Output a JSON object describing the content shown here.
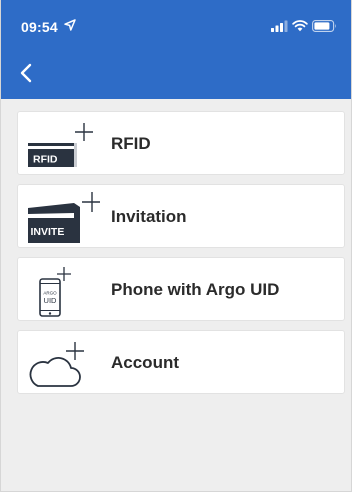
{
  "status_bar": {
    "time": "09:54"
  },
  "menu": {
    "items": [
      {
        "label": "RFID",
        "icon": "rfid-card-icon",
        "card_text": "RFID"
      },
      {
        "label": "Invitation",
        "icon": "invite-card-icon",
        "card_text": "INVITE"
      },
      {
        "label": "Phone with Argo UID",
        "icon": "phone-uid-icon",
        "phone_text_top": "ARGO",
        "phone_text_bottom": "UID"
      },
      {
        "label": "Account",
        "icon": "cloud-account-icon"
      }
    ]
  },
  "colors": {
    "header": "#2e6cc7",
    "background": "#eeeeee",
    "card": "#ffffff",
    "icon_dark": "#2a3340"
  }
}
